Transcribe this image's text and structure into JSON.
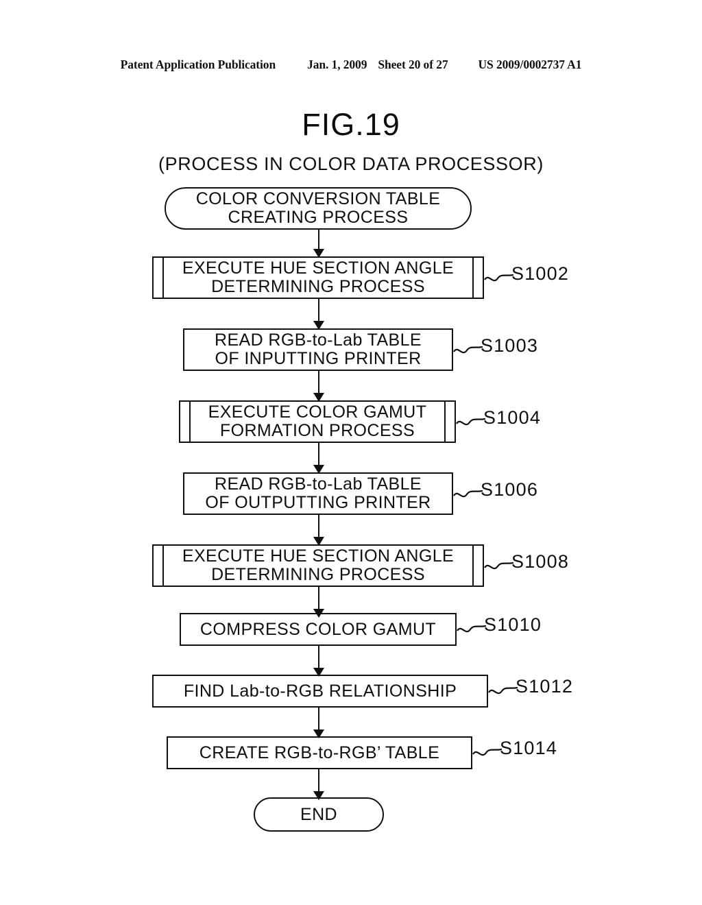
{
  "header": {
    "publication": "Patent Application Publication",
    "date": "Jan. 1, 2009",
    "sheet": "Sheet 20 of 27",
    "number": "US 2009/0002737 A1"
  },
  "figure": {
    "title": "FIG.19",
    "subtitle": "(PROCESS IN COLOR DATA PROCESSOR)"
  },
  "flowchart": {
    "type": "flowchart",
    "orientation": "top-to-bottom",
    "nodes": [
      {
        "id": "start",
        "shape": "terminator",
        "lines": [
          "COLOR CONVERSION TABLE",
          "CREATING PROCESS"
        ],
        "step": ""
      },
      {
        "id": "s1002",
        "shape": "predefined-process",
        "lines": [
          "EXECUTE HUE SECTION ANGLE",
          "DETERMINING PROCESS"
        ],
        "step": "S1002"
      },
      {
        "id": "s1003",
        "shape": "process",
        "lines": [
          "READ RGB-to-Lab TABLE",
          "OF INPUTTING PRINTER"
        ],
        "step": "S1003"
      },
      {
        "id": "s1004",
        "shape": "predefined-process",
        "lines": [
          "EXECUTE COLOR GAMUT",
          "FORMATION PROCESS"
        ],
        "step": "S1004"
      },
      {
        "id": "s1006",
        "shape": "process",
        "lines": [
          "READ RGB-to-Lab TABLE",
          "OF OUTPUTTING PRINTER"
        ],
        "step": "S1006"
      },
      {
        "id": "s1008",
        "shape": "predefined-process",
        "lines": [
          "EXECUTE HUE SECTION ANGLE",
          "DETERMINING PROCESS"
        ],
        "step": "S1008"
      },
      {
        "id": "s1010",
        "shape": "process",
        "lines": [
          "COMPRESS COLOR GAMUT"
        ],
        "step": "S1010"
      },
      {
        "id": "s1012",
        "shape": "process",
        "lines": [
          "FIND Lab-to-RGB RELATIONSHIP"
        ],
        "step": "S1012"
      },
      {
        "id": "s1014",
        "shape": "process",
        "lines": [
          "CREATE RGB-to-RGB’ TABLE"
        ],
        "step": "S1014"
      },
      {
        "id": "end",
        "shape": "terminator",
        "lines": [
          "END"
        ],
        "step": ""
      }
    ]
  },
  "colors": {
    "ink": "#111111",
    "paper": "#ffffff"
  }
}
